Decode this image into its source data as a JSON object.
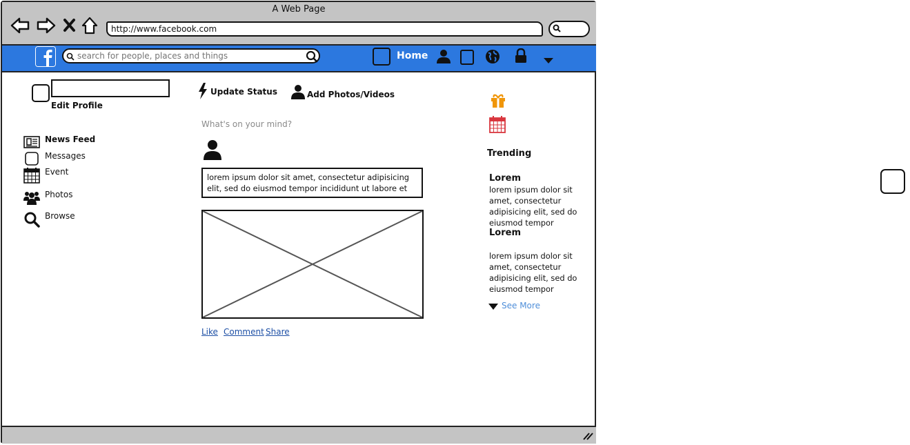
{
  "browser": {
    "title": "A Web Page",
    "url": "http://www.facebook.com"
  },
  "header": {
    "search_placeholder": "search for people, places and things",
    "home_label": "Home",
    "brand_color": "#2c78df"
  },
  "profile": {
    "edit_label": "Edit Profile"
  },
  "sidebar": {
    "items": [
      {
        "label": "News Feed",
        "icon": "newspaper-icon"
      },
      {
        "label": "Messages",
        "icon": "checkbox-icon"
      },
      {
        "label": "Event",
        "icon": "calendar-icon"
      },
      {
        "label": "Photos",
        "icon": "group-icon"
      },
      {
        "label": "Browse",
        "icon": "search-icon"
      }
    ]
  },
  "composer": {
    "update_status": "Update Status",
    "add_photos": "Add Photos/Videos",
    "placeholder": "What's on your mind?"
  },
  "post": {
    "text": "lorem ipsum dolor sit amet, consectetur adipisicing elit, sed do eiusmod tempor incididunt ut labore et",
    "actions": [
      "Like",
      "Comment",
      "Share"
    ]
  },
  "trending": {
    "title": "Trending",
    "items": [
      {
        "title": "Lorem",
        "body": "lorem ipsum dolor sit amet, consectetur adipisicing elit, sed do eiusmod tempor"
      },
      {
        "title": "Lorem",
        "body": "lorem ipsum dolor sit amet, consectetur adipisicing elit, sed do eiusmod tempor"
      }
    ],
    "see_more": "See More"
  }
}
